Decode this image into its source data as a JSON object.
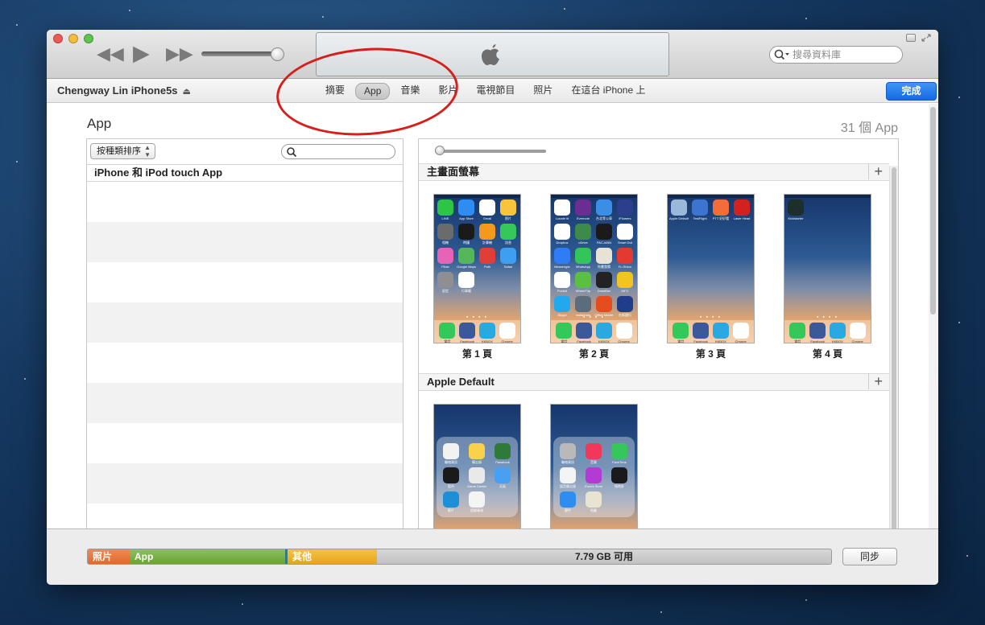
{
  "toolbar": {
    "search_placeholder": "搜尋資料庫"
  },
  "device": {
    "name": "Chengway Lin iPhone5s",
    "done_label": "完成"
  },
  "tabs": [
    "摘要",
    "App",
    "音樂",
    "影片",
    "電視節目",
    "照片",
    "在這台 iPhone 上"
  ],
  "active_tab": "App",
  "main": {
    "title": "App",
    "count": "31 個 App"
  },
  "left_panel": {
    "sort_label": "按種類排序",
    "list_header": "iPhone 和 iPod touch App"
  },
  "right_panel": {
    "home_screens_header": "主畫面螢幕",
    "apple_default_header": "Apple Default",
    "pages": [
      {
        "label": "第 1 頁",
        "icons": [
          {
            "name": "LINE",
            "color": "#2ec445"
          },
          {
            "name": "App Store",
            "color": "#2e8df5"
          },
          {
            "name": "Gmail",
            "color": "#ffffff"
          },
          {
            "name": "照片",
            "color": "#f7c43b"
          },
          {
            "name": "相機",
            "color": "#6b6b6b"
          },
          {
            "name": "時鐘",
            "color": "#1a1a1a"
          },
          {
            "name": "計算機",
            "color": "#f39a1d"
          },
          {
            "name": "訊息",
            "color": "#35c759"
          },
          {
            "name": "Flickr",
            "color": "#e663b5"
          },
          {
            "name": "Google Maps",
            "color": "#56b65a"
          },
          {
            "name": "Path",
            "color": "#e23e38"
          },
          {
            "name": "Safari",
            "color": "#3e9ef0"
          },
          {
            "name": "設定",
            "color": "#8e8e93"
          },
          {
            "name": "行事曆",
            "color": "#ffffff"
          }
        ]
      },
      {
        "label": "第 2 頁",
        "icons": [
          {
            "name": "Locate iit",
            "color": "#ffffff"
          },
          {
            "name": "Evernote",
            "color": "#6b2d8f"
          },
          {
            "name": "台北等公車",
            "color": "#3a8ee6"
          },
          {
            "name": "iFlowers",
            "color": "#2c3f8d"
          },
          {
            "name": "Dropbox",
            "color": "#ffffff"
          },
          {
            "name": "uDrive",
            "color": "#3c8b4a"
          },
          {
            "name": "PAC-MAN",
            "color": "#1a1a1a"
          },
          {
            "name": "Smart Dot",
            "color": "#ffffff"
          },
          {
            "name": "Messenger",
            "color": "#2e7cf6"
          },
          {
            "name": "WhatsApp",
            "color": "#33c45a"
          },
          {
            "name": "你畫我猜",
            "color": "#e8e2d4"
          },
          {
            "name": "Fu Shion",
            "color": "#e23a30"
          },
          {
            "name": "Pocket",
            "color": "#ffffff"
          },
          {
            "name": "WhereTrip",
            "color": "#5bbf43"
          },
          {
            "name": "DrawBox",
            "color": "#222222"
          },
          {
            "name": "85°C",
            "color": "#f2c41f"
          },
          {
            "name": "Skype",
            "color": "#22a8ef"
          },
          {
            "name": "Instaphoto",
            "color": "#5b6d7c"
          },
          {
            "name": "Office Mobile",
            "color": "#e54d1f"
          },
          {
            "name": "台新銀行",
            "color": "#1f3d8b"
          }
        ]
      },
      {
        "label": "第 3 頁",
        "icons": [
          {
            "name": "Apple Default",
            "color": "#9ab8da"
          },
          {
            "name": "TestFlight",
            "color": "#3c74d0"
          },
          {
            "name": "PTT 好好看",
            "color": "#f36c3a"
          },
          {
            "name": "Laser Head",
            "color": "#d3211e"
          }
        ]
      },
      {
        "label": "第 4 頁",
        "icons": [
          {
            "name": "Kickstarter",
            "color": "#1c2f2a"
          }
        ]
      }
    ],
    "dock": [
      {
        "name": "電話",
        "color": "#34c759"
      },
      {
        "name": "Facebook",
        "color": "#3b5998"
      },
      {
        "name": "KKBOX",
        "color": "#2aa8e0"
      },
      {
        "name": "Chrome",
        "color": "#ffffff"
      }
    ],
    "default_pages": [
      {
        "icons": [
          {
            "name": "聯絡資訊",
            "color": "#f2f2f2"
          },
          {
            "name": "備忘錄",
            "color": "#f8d24a"
          },
          {
            "name": "Passbook",
            "color": "#2f7a3a"
          },
          {
            "name": "股市",
            "color": "#1a1a1a"
          },
          {
            "name": "Game Center",
            "color": "#e9e9e9"
          },
          {
            "name": "天氣",
            "color": "#4aa0f0"
          },
          {
            "name": "影片",
            "color": "#1c8fd6"
          },
          {
            "name": "提醒事項",
            "color": "#f4f4f4"
          }
        ]
      },
      {
        "icons": [
          {
            "name": "聯絡資訊",
            "color": "#b9b9b9"
          },
          {
            "name": "音樂",
            "color": "#f2385a"
          },
          {
            "name": "FaceTime",
            "color": "#36c75a"
          },
          {
            "name": "語音備忘錄",
            "color": "#f4f4f4"
          },
          {
            "name": "iTunes Store",
            "color": "#b43ad6"
          },
          {
            "name": "指南針",
            "color": "#1a1a1a"
          },
          {
            "name": "郵件",
            "color": "#2d8df0"
          },
          {
            "name": "地圖",
            "color": "#e9e4cf"
          }
        ]
      }
    ]
  },
  "storage": {
    "photos_label": "照片",
    "apps_label": "App",
    "other_label": "其他",
    "free_label": "7.79 GB 可用",
    "colors": {
      "photos": "#df6a2e",
      "apps": "#6aa33a",
      "other": "#e3a61d"
    }
  },
  "sync_label": "同步",
  "annotation": {
    "color": "#d61f1b",
    "icon": "red-circle-annotation"
  }
}
